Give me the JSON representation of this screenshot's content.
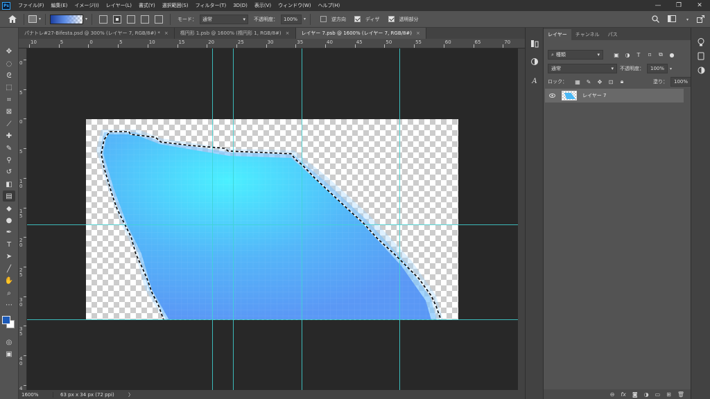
{
  "app": {
    "logo": "Ps"
  },
  "menu": [
    "ファイル(F)",
    "編集(E)",
    "イメージ(I)",
    "レイヤー(L)",
    "書式(Y)",
    "選択範囲(S)",
    "フィルター(T)",
    "3D(D)",
    "表示(V)",
    "ウィンドウ(W)",
    "ヘルプ(H)"
  ],
  "window_controls": {
    "minimize": "—",
    "restore": "❐",
    "close": "✕"
  },
  "options": {
    "mode_label": "モード：",
    "mode_value": "通常",
    "opacity_label": "不透明度：",
    "opacity_value": "100%",
    "reverse_label": "逆方向",
    "dither_label": "ディザ",
    "transparency_label": "透明部分",
    "reverse_checked": false,
    "dither_checked": true,
    "transparency_checked": true
  },
  "tabs": [
    {
      "label": "パナトレ#27-Bifesta.psd @ 300% (レイヤー 7, RGB/8#) *",
      "close": "×",
      "active": false
    },
    {
      "label": "楕円形 1.psb @ 1600% (楕円形 1, RGB/8#)",
      "close": "×",
      "active": false
    },
    {
      "label": "レイヤー 7.psb @ 1600% (レイヤー 7, RGB/8#)",
      "close": "×",
      "active": true
    }
  ],
  "ruler_top": [
    "10",
    "5",
    "0",
    "5",
    "10",
    "15",
    "20",
    "25",
    "30",
    "35",
    "40",
    "45",
    "50",
    "55",
    "60",
    "65",
    "70"
  ],
  "ruler_left": [
    "0",
    "5",
    "0",
    "5",
    "1 0",
    "1 5",
    "2 0",
    "2 5",
    "3 0",
    "3 5",
    "4 0",
    "4"
  ],
  "status": {
    "zoom": "1600%",
    "size": "63 px x 34 px (72 ppi)",
    "arrow": "〉"
  },
  "layers_panel": {
    "tabs": [
      "レイヤー",
      "チャンネル",
      "パス"
    ],
    "filter_value": "種類",
    "blend_value": "通常",
    "opacity_label": "不透明度：",
    "opacity_value": "100%",
    "lock_label": "ロック：",
    "fill_label": "塗り：",
    "fill_value": "100%",
    "layers": [
      {
        "name": "レイヤー 7"
      }
    ]
  },
  "colors": {
    "foreground": "#1c5ab8",
    "background": "#ffffff",
    "guide": "#3fd3d3",
    "fill_light": "#4af0ff",
    "fill_main": "#4fa3f7"
  }
}
